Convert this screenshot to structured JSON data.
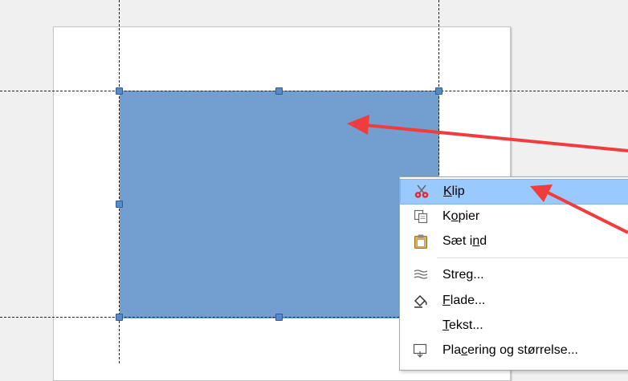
{
  "menu": {
    "items": [
      {
        "id": "klip",
        "pre": "",
        "mn": "K",
        "post": "lip",
        "icon": "scissors-icon",
        "highlighted": true
      },
      {
        "id": "kopier",
        "pre": "K",
        "mn": "o",
        "post": "pier",
        "icon": "copy-icon"
      },
      {
        "id": "saet-ind",
        "pre": "Sæt i",
        "mn": "n",
        "post": "d",
        "icon": "paste-icon"
      },
      {
        "id": "streg",
        "pre": "Stre",
        "mn": "g",
        "post": "...",
        "icon": "line-icon"
      },
      {
        "id": "flade",
        "pre": "",
        "mn": "F",
        "post": "lade...",
        "icon": "fill-bucket-icon"
      },
      {
        "id": "tekst",
        "pre": "",
        "mn": "T",
        "post": "ekst...",
        "icon": ""
      },
      {
        "id": "placering",
        "pre": "Pla",
        "mn": "c",
        "post": "ering og størrelse...",
        "icon": "position-size-icon"
      }
    ]
  },
  "colors": {
    "shape_fill": "#729fcf",
    "highlight": "#99c9ff",
    "annotation_arrow": "#f03c3c"
  }
}
